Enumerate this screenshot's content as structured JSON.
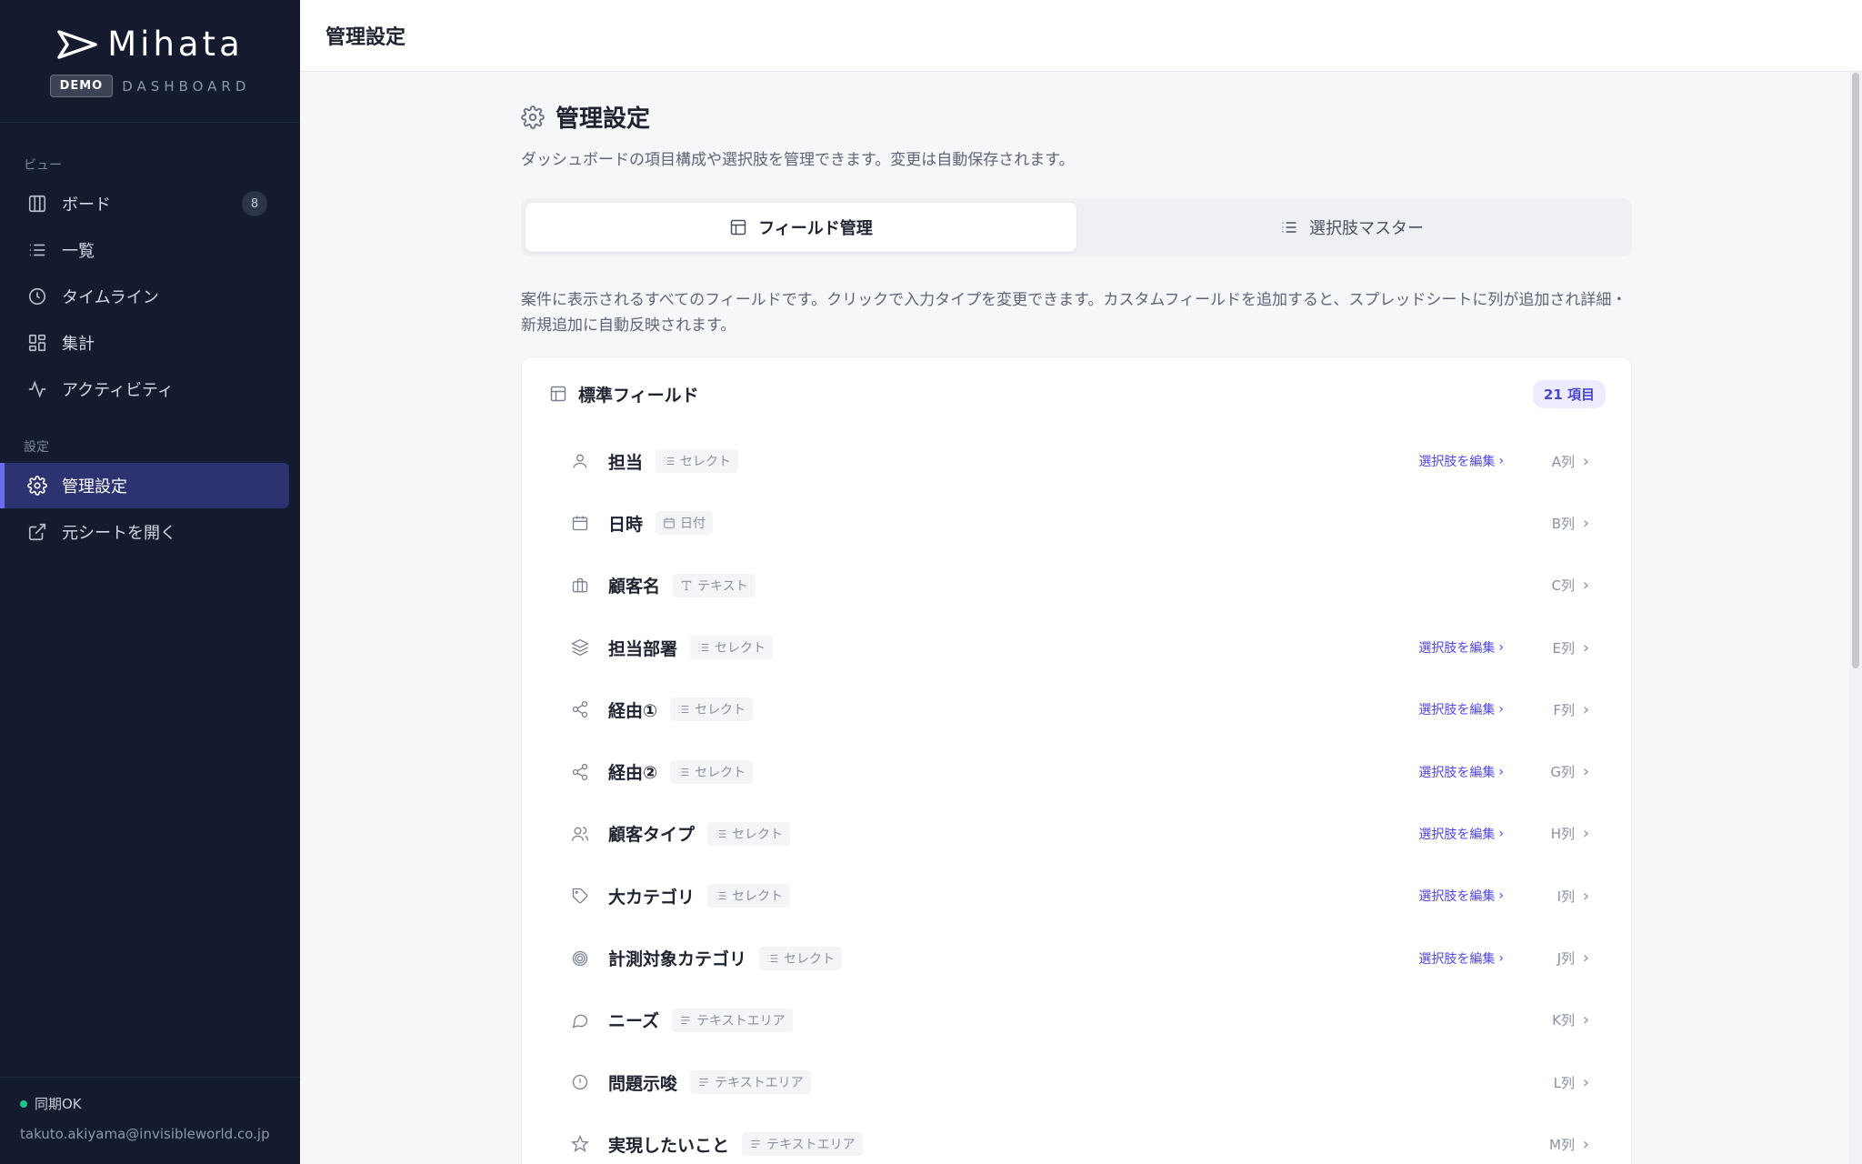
{
  "app": {
    "name": "Mihata",
    "badge": "DEMO",
    "subtitle": "DASHBOARD"
  },
  "sidebar": {
    "section_view": "ビュー",
    "section_settings": "設定",
    "items": [
      {
        "label": "ボード",
        "icon": "board-icon",
        "count": "8"
      },
      {
        "label": "一覧",
        "icon": "list-icon"
      },
      {
        "label": "タイムライン",
        "icon": "clock-icon"
      },
      {
        "label": "集計",
        "icon": "grid-icon"
      },
      {
        "label": "アクティビティ",
        "icon": "activity-icon"
      },
      {
        "label": "管理設定",
        "icon": "gear-icon",
        "active": true
      },
      {
        "label": "元シートを開く",
        "icon": "external-link-icon"
      }
    ],
    "sync_status": "同期OK",
    "user_email": "takuto.akiyama@invisibleworld.co.jp"
  },
  "topbar": {
    "title": "管理設定"
  },
  "page": {
    "title": "管理設定",
    "description": "ダッシュボードの項目構成や選択肢を管理できます。変更は自動保存されます。",
    "tabs": [
      {
        "label": "フィールド管理",
        "icon": "layout-icon",
        "active": true
      },
      {
        "label": "選択肢マスター",
        "icon": "list-icon",
        "active": false
      }
    ],
    "section_description": "案件に表示されるすべてのフィールドです。クリックで入力タイプを変更できます。カスタムフィールドを追加すると、スプレッドシートに列が追加され詳細・新規追加に自動反映されます。"
  },
  "standard_fields": {
    "title": "標準フィールド",
    "count": "21 項目",
    "edit_label": "選択肢を編集",
    "rows": [
      {
        "name": "担当",
        "type": "セレクト",
        "type_icon": "list-icon",
        "icon": "user-icon",
        "column": "A列",
        "editable": true
      },
      {
        "name": "日時",
        "type": "日付",
        "type_icon": "calendar-icon",
        "icon": "calendar-icon",
        "column": "B列",
        "editable": false
      },
      {
        "name": "顧客名",
        "type": "テキスト",
        "type_icon": "text-icon",
        "icon": "briefcase-icon",
        "column": "C列",
        "editable": false
      },
      {
        "name": "担当部署",
        "type": "セレクト",
        "type_icon": "list-icon",
        "icon": "layers-icon",
        "column": "E列",
        "editable": true
      },
      {
        "name": "経由①",
        "type": "セレクト",
        "type_icon": "list-icon",
        "icon": "share-icon",
        "column": "F列",
        "editable": true
      },
      {
        "name": "経由②",
        "type": "セレクト",
        "type_icon": "list-icon",
        "icon": "share-icon",
        "column": "G列",
        "editable": true
      },
      {
        "name": "顧客タイプ",
        "type": "セレクト",
        "type_icon": "list-icon",
        "icon": "users-icon",
        "column": "H列",
        "editable": true
      },
      {
        "name": "大カテゴリ",
        "type": "セレクト",
        "type_icon": "list-icon",
        "icon": "tag-icon",
        "column": "I列",
        "editable": true
      },
      {
        "name": "計測対象カテゴリ",
        "type": "セレクト",
        "type_icon": "list-icon",
        "icon": "target-icon",
        "column": "J列",
        "editable": true
      },
      {
        "name": "ニーズ",
        "type": "テキストエリア",
        "type_icon": "textarea-icon",
        "icon": "message-icon",
        "column": "K列",
        "editable": false
      },
      {
        "name": "問題示唆",
        "type": "テキストエリア",
        "type_icon": "textarea-icon",
        "icon": "alert-icon",
        "column": "L列",
        "editable": false
      },
      {
        "name": "実現したいこと",
        "type": "テキストエリア",
        "type_icon": "textarea-icon",
        "icon": "star-icon",
        "column": "M列",
        "editable": false
      }
    ]
  }
}
